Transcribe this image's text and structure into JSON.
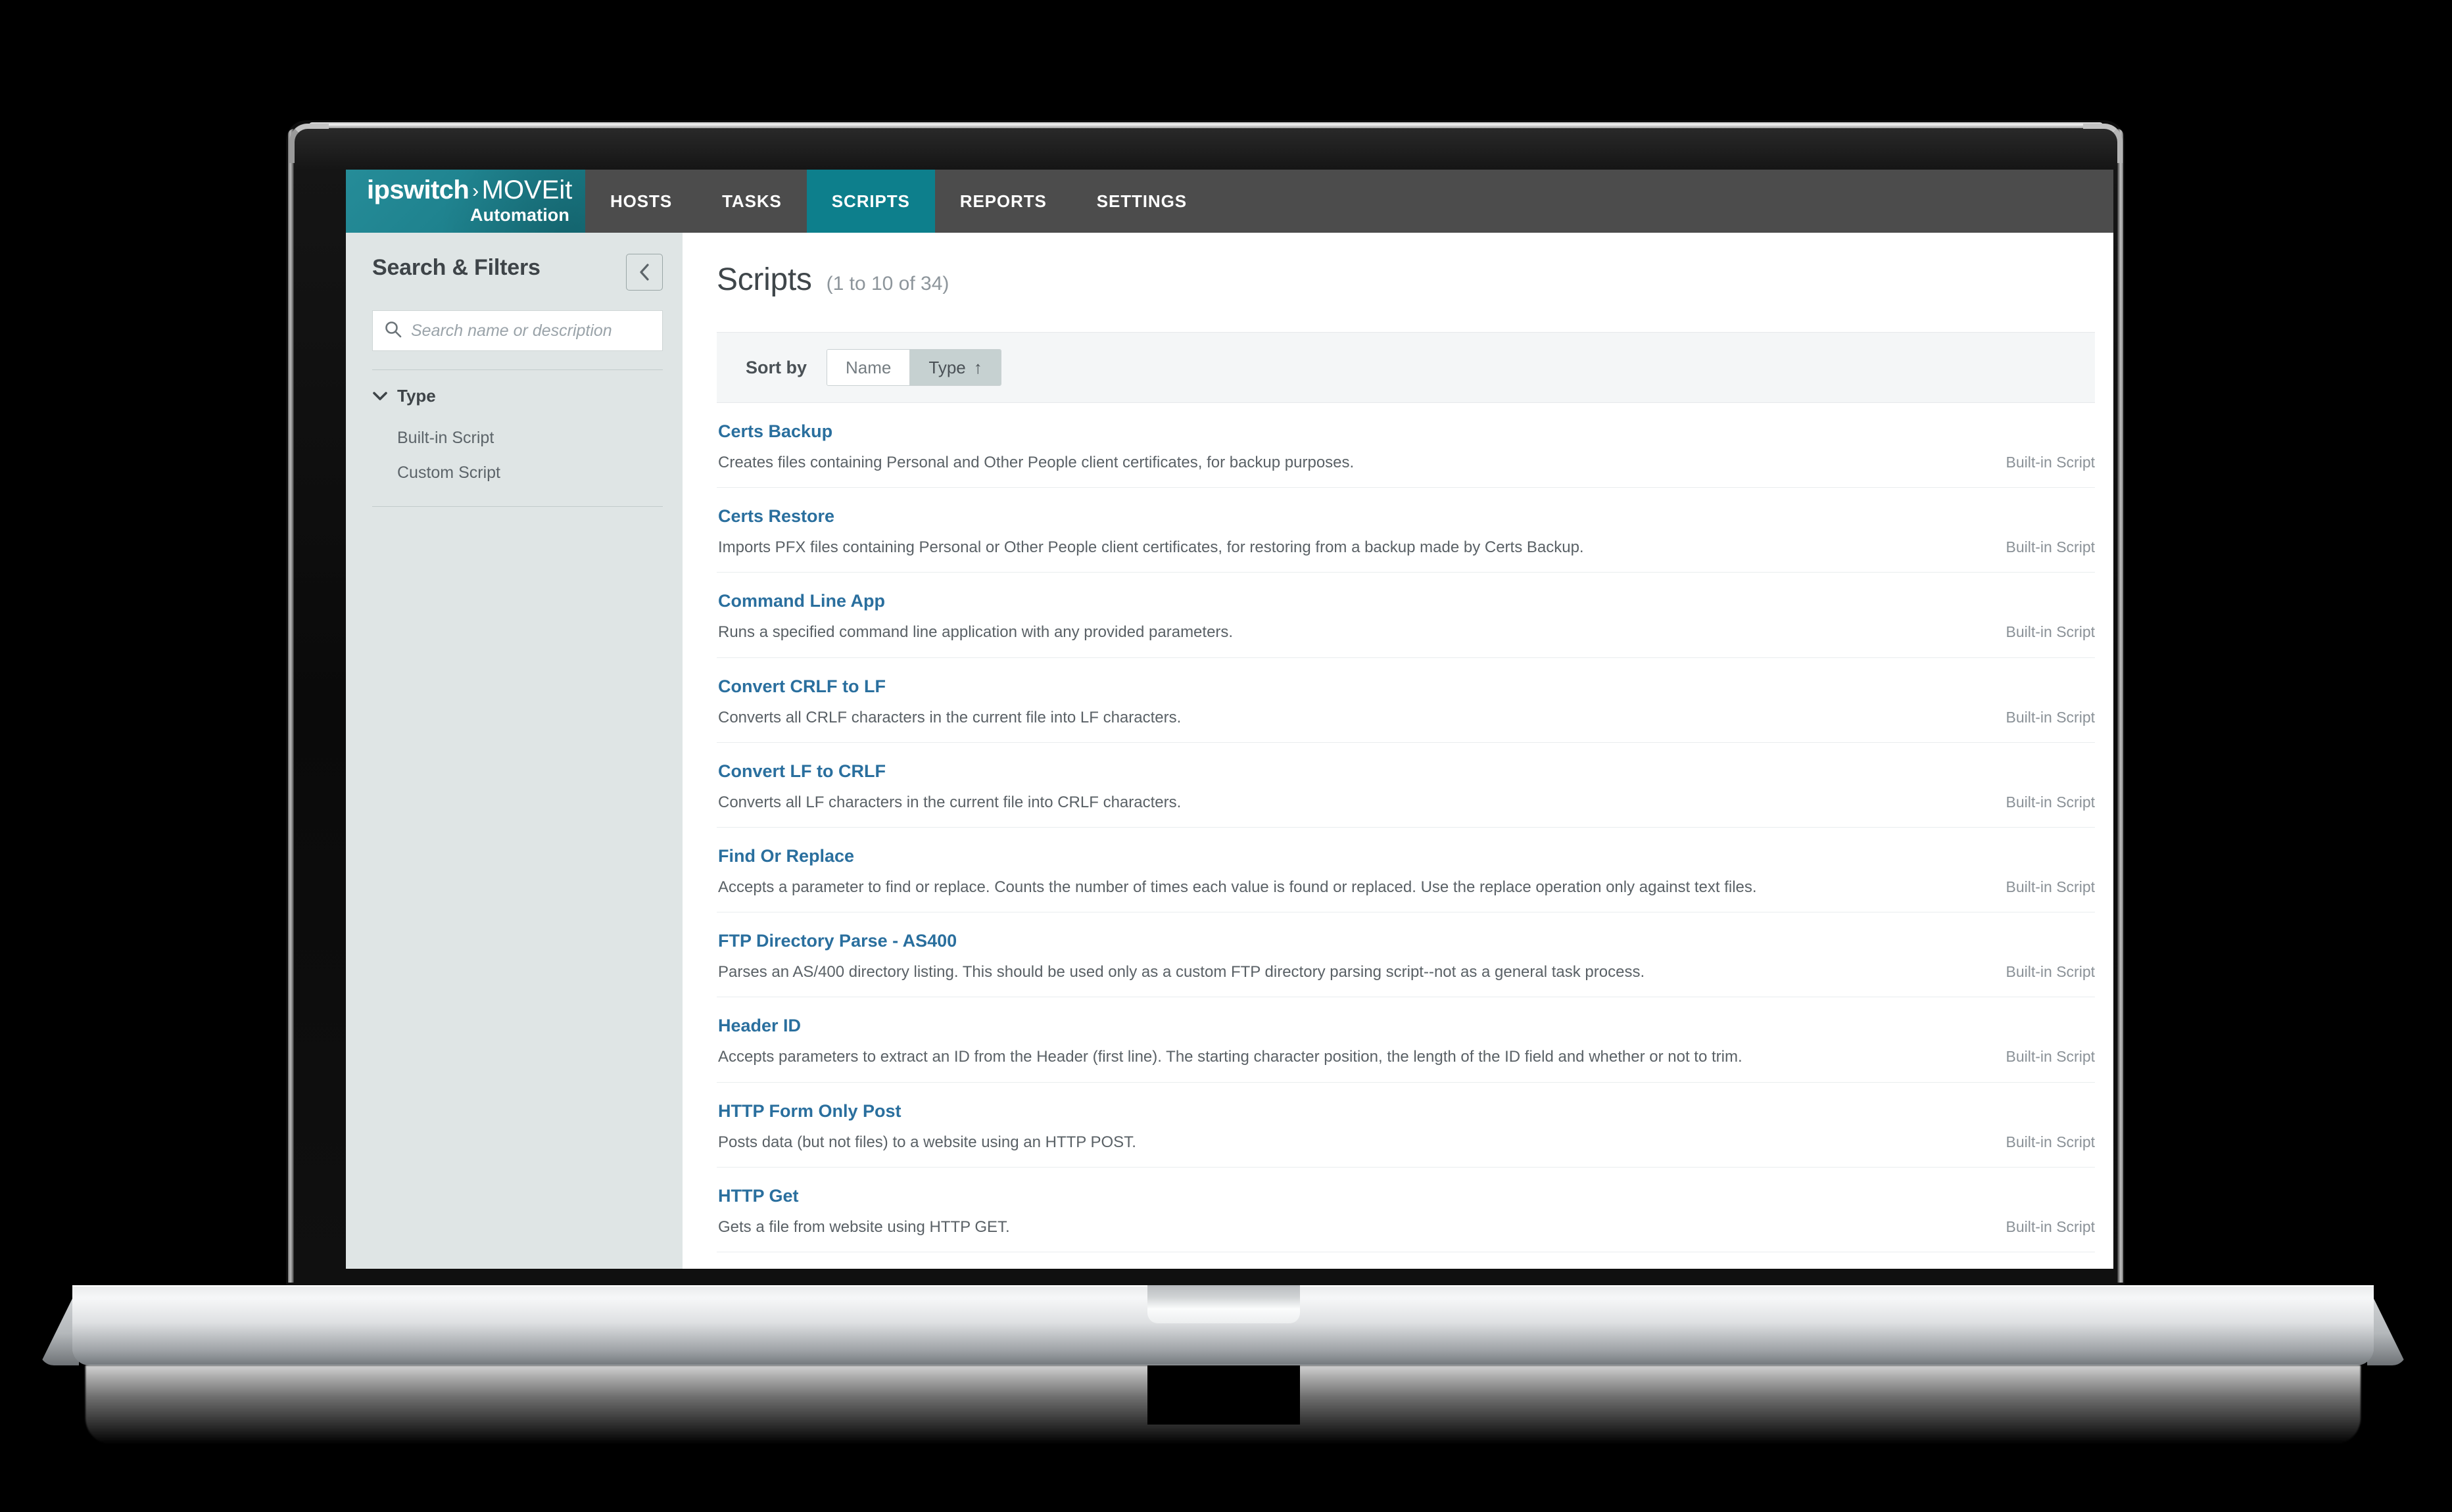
{
  "app": {
    "logo": {
      "brand": "ipswitch",
      "separator": "›",
      "product": "MOVEit",
      "subtitle": "Automation"
    },
    "nav": [
      {
        "label": "HOSTS",
        "active": false
      },
      {
        "label": "TASKS",
        "active": false
      },
      {
        "label": "SCRIPTS",
        "active": true
      },
      {
        "label": "REPORTS",
        "active": false
      },
      {
        "label": "SETTINGS",
        "active": false
      }
    ]
  },
  "sidebar": {
    "title": "Search & Filters",
    "collapse_icon": "chevron-left-icon",
    "search": {
      "icon": "search-icon",
      "placeholder": "Search name or description",
      "value": ""
    },
    "filter_groups": [
      {
        "label": "Type",
        "icon": "chevron-down-icon",
        "items": [
          {
            "label": "Built-in Script"
          },
          {
            "label": "Custom Script"
          }
        ]
      }
    ]
  },
  "main": {
    "title": "Scripts",
    "count": "(1 to 10 of 34)",
    "sort": {
      "label": "Sort by",
      "options": [
        {
          "label": "Name",
          "active": false,
          "arrow": ""
        },
        {
          "label": "Type",
          "active": true,
          "arrow": "↑"
        }
      ]
    },
    "rows": [
      {
        "name": "Certs Backup",
        "description": "Creates files containing Personal and Other People client certificates, for backup purposes.",
        "type": "Built-in Script"
      },
      {
        "name": "Certs Restore",
        "description": "Imports PFX files containing Personal or Other People client certificates, for restoring from a backup made by Certs Backup.",
        "type": "Built-in Script"
      },
      {
        "name": "Command Line App",
        "description": "Runs a specified command line application with any provided parameters.",
        "type": "Built-in Script"
      },
      {
        "name": "Convert CRLF to LF",
        "description": "Converts all CRLF characters in the current file into LF characters.",
        "type": "Built-in Script"
      },
      {
        "name": "Convert LF to CRLF",
        "description": "Converts all LF characters in the current file into CRLF characters.",
        "type": "Built-in Script"
      },
      {
        "name": "Find Or Replace",
        "description": "Accepts a parameter to find or replace. Counts the number of times each value is found or replaced. Use the replace operation only against text files.",
        "type": "Built-in Script"
      },
      {
        "name": "FTP Directory Parse - AS400",
        "description": "Parses an AS/400 directory listing. This should be used only as a custom FTP directory parsing script--not as a general task process.",
        "type": "Built-in Script"
      },
      {
        "name": "Header ID",
        "description": "Accepts parameters to extract an ID from the Header (first line). The starting character position, the length of the ID field and whether or not to trim.",
        "type": "Built-in Script"
      },
      {
        "name": "HTTP Form Only Post",
        "description": "Posts data (but not files) to a website using an HTTP POST.",
        "type": "Built-in Script"
      },
      {
        "name": "HTTP Get",
        "description": "Gets a file from website using HTTP GET.",
        "type": "Built-in Script"
      }
    ]
  },
  "colors": {
    "brand_teal": "#1a8693",
    "active_tab_teal": "#0d7f8c",
    "nav_dark": "#4c4c4c",
    "sidebar_bg": "#dfe5e5",
    "link_blue": "#2a6f9e"
  }
}
